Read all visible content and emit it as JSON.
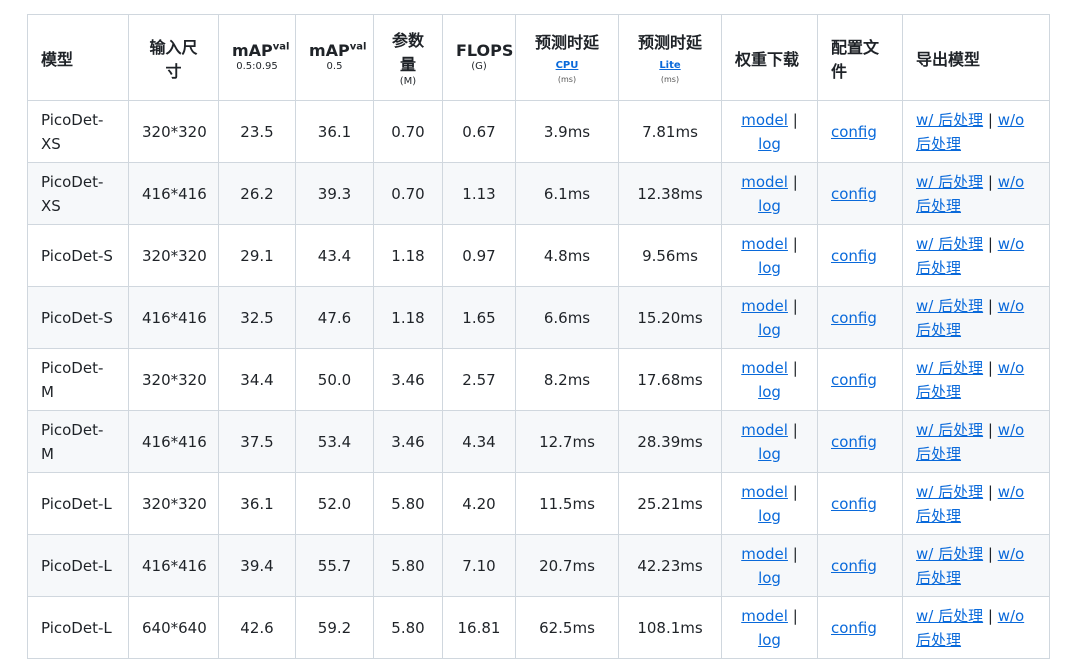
{
  "headers": {
    "model": "模型",
    "input_size": "输入尺寸",
    "map1_main": "mAP",
    "map1_sup": "val",
    "map1_sub": "0.5:0.95",
    "map2_main": "mAP",
    "map2_sup": "val",
    "map2_sub": "0.5",
    "params_main": "参数量",
    "params_sub": "(M)",
    "flops_main": "FLOPS",
    "flops_sub": "(G)",
    "cpu_main": "预测时延",
    "cpu_link": "CPU",
    "cpu_unit": "(ms)",
    "lite_main": "预测时延",
    "lite_link": "Lite",
    "lite_unit": "(ms)",
    "weights": "权重下载",
    "config": "配置文件",
    "export": "导出模型"
  },
  "links": {
    "model": "model",
    "sep": " | ",
    "log": "log",
    "config": "config",
    "with_post": "w/ 后处理",
    "without_post": "w/o 后处理"
  },
  "rows": [
    {
      "model": "PicoDet-XS",
      "size": "320*320",
      "map1": "23.5",
      "map2": "36.1",
      "params": "0.70",
      "flops": "0.67",
      "cpu": "3.9ms",
      "lite": "7.81ms"
    },
    {
      "model": "PicoDet-XS",
      "size": "416*416",
      "map1": "26.2",
      "map2": "39.3",
      "params": "0.70",
      "flops": "1.13",
      "cpu": "6.1ms",
      "lite": "12.38ms"
    },
    {
      "model": "PicoDet-S",
      "size": "320*320",
      "map1": "29.1",
      "map2": "43.4",
      "params": "1.18",
      "flops": "0.97",
      "cpu": "4.8ms",
      "lite": "9.56ms"
    },
    {
      "model": "PicoDet-S",
      "size": "416*416",
      "map1": "32.5",
      "map2": "47.6",
      "params": "1.18",
      "flops": "1.65",
      "cpu": "6.6ms",
      "lite": "15.20ms"
    },
    {
      "model": "PicoDet-M",
      "size": "320*320",
      "map1": "34.4",
      "map2": "50.0",
      "params": "3.46",
      "flops": "2.57",
      "cpu": "8.2ms",
      "lite": "17.68ms"
    },
    {
      "model": "PicoDet-M",
      "size": "416*416",
      "map1": "37.5",
      "map2": "53.4",
      "params": "3.46",
      "flops": "4.34",
      "cpu": "12.7ms",
      "lite": "28.39ms"
    },
    {
      "model": "PicoDet-L",
      "size": "320*320",
      "map1": "36.1",
      "map2": "52.0",
      "params": "5.80",
      "flops": "4.20",
      "cpu": "11.5ms",
      "lite": "25.21ms"
    },
    {
      "model": "PicoDet-L",
      "size": "416*416",
      "map1": "39.4",
      "map2": "55.7",
      "params": "5.80",
      "flops": "7.10",
      "cpu": "20.7ms",
      "lite": "42.23ms"
    },
    {
      "model": "PicoDet-L",
      "size": "640*640",
      "map1": "42.6",
      "map2": "59.2",
      "params": "5.80",
      "flops": "16.81",
      "cpu": "62.5ms",
      "lite": "108.1ms"
    }
  ]
}
